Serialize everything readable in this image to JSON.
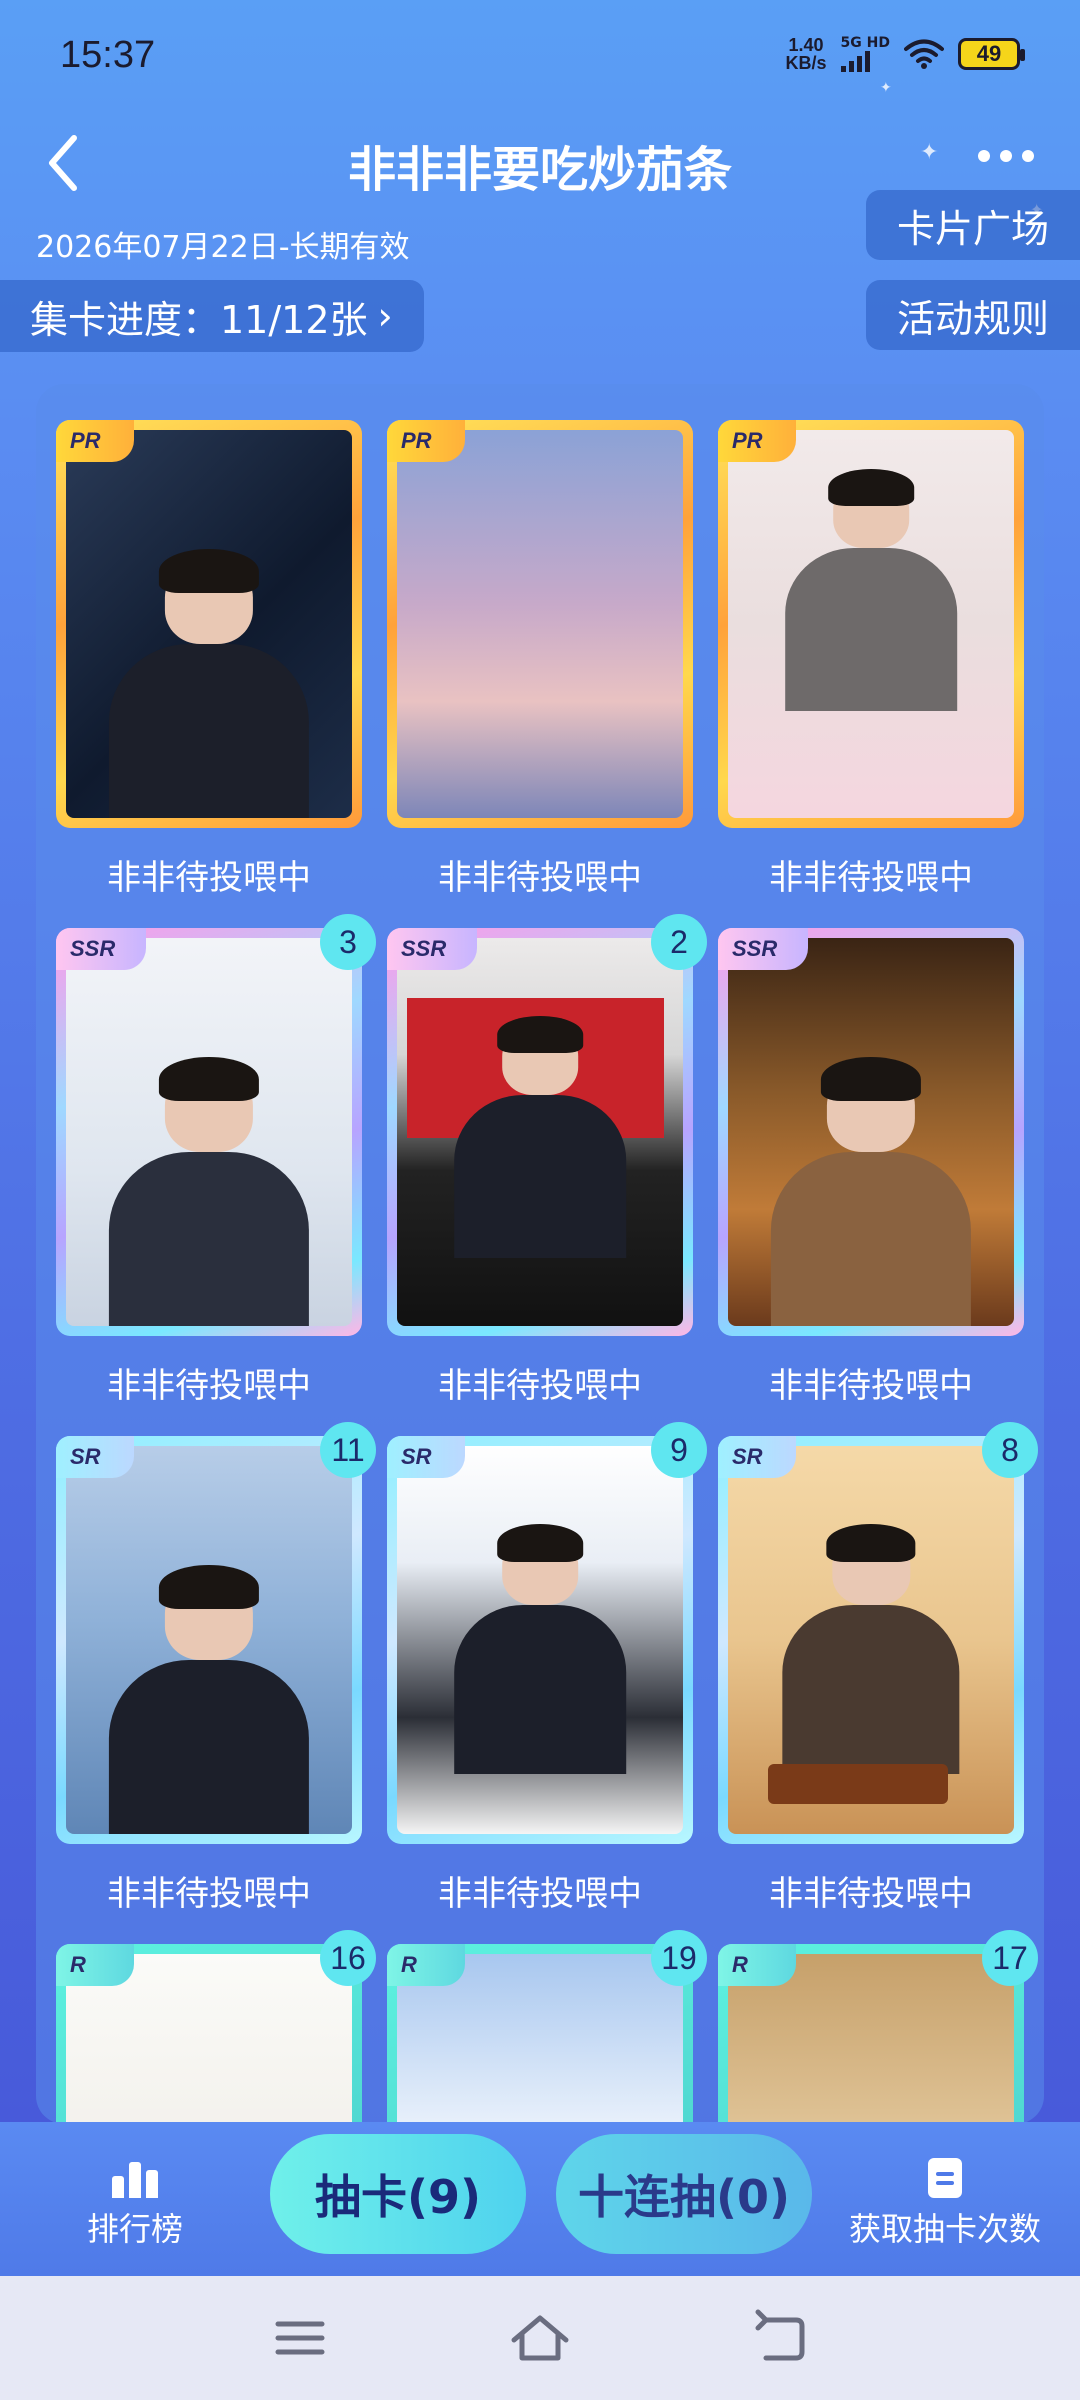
{
  "status_bar": {
    "time": "15:37",
    "net_speed_value": "1.40",
    "net_speed_unit": "KB/s",
    "network": "5G HD",
    "battery": "49"
  },
  "header": {
    "title": "非非非要吃炒茄条",
    "back_icon": "chevron-left-icon",
    "more_icon": "more-dots-icon"
  },
  "info": {
    "date_range": "2026年07月22日-长期有效",
    "progress": "集卡进度：11/12张",
    "progress_arrow": "›",
    "square_button": "卡片广场",
    "rules_button": "活动规则"
  },
  "cards": [
    {
      "rarity": "PR",
      "count": "",
      "caption": "非非待投喂中"
    },
    {
      "rarity": "PR",
      "count": "",
      "caption": "非非待投喂中"
    },
    {
      "rarity": "PR",
      "count": "",
      "caption": "非非待投喂中"
    },
    {
      "rarity": "SSR",
      "count": "3",
      "caption": "非非待投喂中"
    },
    {
      "rarity": "SSR",
      "count": "2",
      "caption": "非非待投喂中"
    },
    {
      "rarity": "SSR",
      "count": "",
      "caption": "非非待投喂中"
    },
    {
      "rarity": "SR",
      "count": "11",
      "caption": "非非待投喂中"
    },
    {
      "rarity": "SR",
      "count": "9",
      "caption": "非非待投喂中"
    },
    {
      "rarity": "SR",
      "count": "8",
      "caption": "非非待投喂中"
    },
    {
      "rarity": "R",
      "count": "16",
      "caption": ""
    },
    {
      "rarity": "R",
      "count": "19",
      "caption": ""
    },
    {
      "rarity": "R",
      "count": "17",
      "caption": ""
    }
  ],
  "action_bar": {
    "rank_label": "排行榜",
    "draw_label": "抽卡(9)",
    "draw10_label": "十连抽(0)",
    "get_label": "获取抽卡次数"
  },
  "nav": {
    "menu_icon": "menu-icon",
    "home_icon": "home-icon",
    "back_icon": "back-icon"
  }
}
